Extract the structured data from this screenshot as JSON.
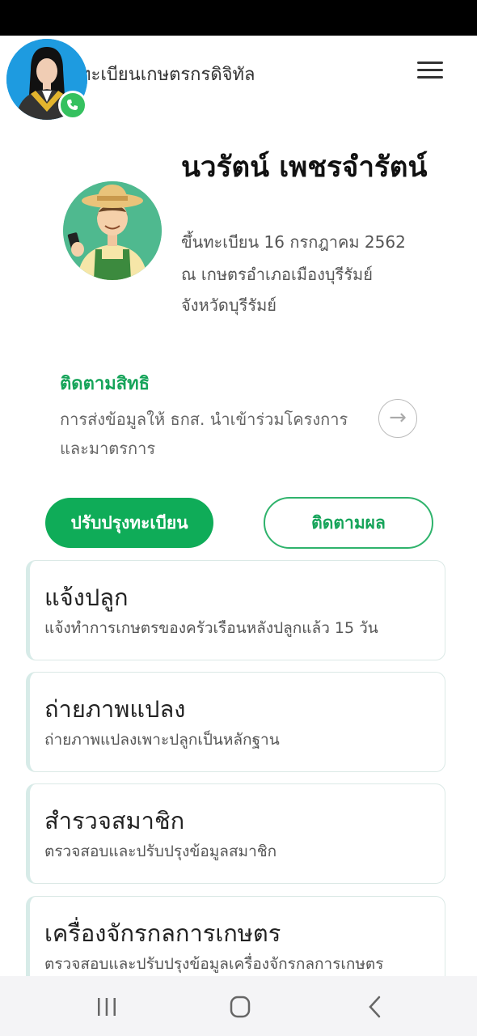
{
  "header": {
    "title": "ทะเบียนเกษตรกรดิจิทัล"
  },
  "profile": {
    "name": "นวรัตน์ เพชรจำรัตน์",
    "registered": "ขึ้นทะเบียน 16 กรกฎาคม 2562",
    "office": "ณ เกษตรอำเภอเมืองบุรีรัมย์",
    "province": "จังหวัดบุรีรัมย์"
  },
  "rights": {
    "title": "ติดตามสิทธิ",
    "description": "การส่งข้อมูลให้ ธกส. นำเข้าร่วมโครงการและมาตรการ",
    "arrow": "→"
  },
  "actions": {
    "update_label": "ปรับปรุงทะเบียน",
    "track_label": "ติดตามผล"
  },
  "cards": [
    {
      "title": "แจ้งปลูก",
      "subtitle": "แจ้งทำการเกษตรของครัวเรือนหลังปลูกแล้ว 15 วัน"
    },
    {
      "title": "ถ่ายภาพแปลง",
      "subtitle": "ถ่ายภาพแปลงเพาะปลูกเป็นหลักฐาน"
    },
    {
      "title": "สำรวจสมาชิก",
      "subtitle": "ตรวจสอบและปรับปรุงข้อมูลสมาชิก"
    },
    {
      "title": "เครื่องจักรกลการเกษตร",
      "subtitle": "ตรวจสอบและปรับปรุงข้อมูลเครื่องจักรกลการเกษตร"
    }
  ],
  "colors": {
    "primary": "#0fac58",
    "accent_text": "#16a45a",
    "status_bar": "#000000",
    "call_badge": "#35c15f"
  },
  "icons": {
    "menu": "hamburger-menu-icon",
    "call": "phone-icon",
    "arrow": "arrow-right-icon",
    "nav_recent": "recent-apps-icon",
    "nav_home": "home-icon",
    "nav_back": "back-icon"
  }
}
